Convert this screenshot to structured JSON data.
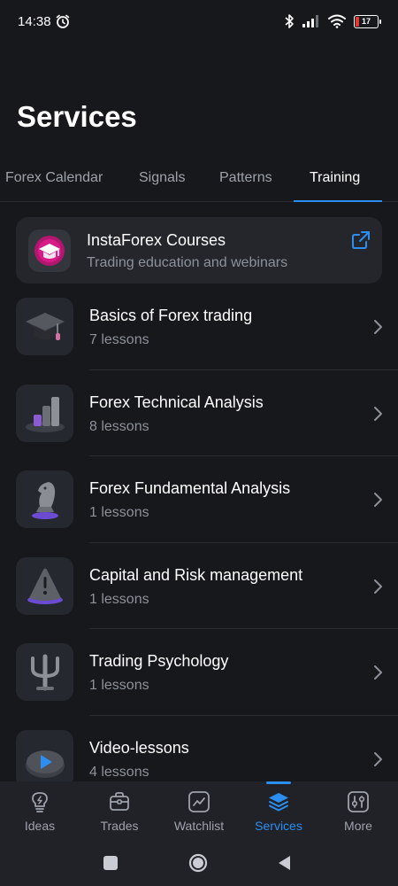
{
  "status_bar": {
    "time": "14:38",
    "battery": "17",
    "battery_level": 0.17,
    "icons": [
      "alarm-icon",
      "bluetooth-icon",
      "signal-icon",
      "wifi-icon",
      "battery-icon"
    ]
  },
  "page": {
    "title": "Services"
  },
  "tabs": [
    {
      "label": "Forex Calendar",
      "active": false
    },
    {
      "label": "Signals",
      "active": false
    },
    {
      "label": "Patterns",
      "active": false
    },
    {
      "label": "Training",
      "active": true
    }
  ],
  "featured": {
    "title": "InstaForex Courses",
    "subtitle": "Trading education and webinars",
    "icon": "graduation-cap-logo",
    "action_icon": "external-link-icon"
  },
  "courses": [
    {
      "title": "Basics of Forex trading",
      "subtitle": "7 lessons",
      "icon": "graduation-cap-icon"
    },
    {
      "title": "Forex Technical Analysis",
      "subtitle": "8 lessons",
      "icon": "bar-chart-icon"
    },
    {
      "title": "Forex Fundamental Analysis",
      "subtitle": "1 lessons",
      "icon": "chess-knight-icon"
    },
    {
      "title": "Capital and Risk management",
      "subtitle": "1 lessons",
      "icon": "warning-cone-icon"
    },
    {
      "title": "Trading Psychology",
      "subtitle": "1 lessons",
      "icon": "psi-icon"
    },
    {
      "title": "Video-lessons",
      "subtitle": "4 lessons",
      "icon": "play-icon"
    }
  ],
  "bottom_nav": [
    {
      "label": "Ideas",
      "icon": "lightbulb-icon",
      "active": false
    },
    {
      "label": "Trades",
      "icon": "briefcase-icon",
      "active": false
    },
    {
      "label": "Watchlist",
      "icon": "chart-icon",
      "active": false
    },
    {
      "label": "Services",
      "icon": "layers-icon",
      "active": true
    },
    {
      "label": "More",
      "icon": "sliders-icon",
      "active": false
    }
  ],
  "colors": {
    "background": "#17181c",
    "card": "#24262c",
    "accent": "#2b8ef0",
    "muted_text": "#8c919a",
    "brand": "#c2187a"
  }
}
